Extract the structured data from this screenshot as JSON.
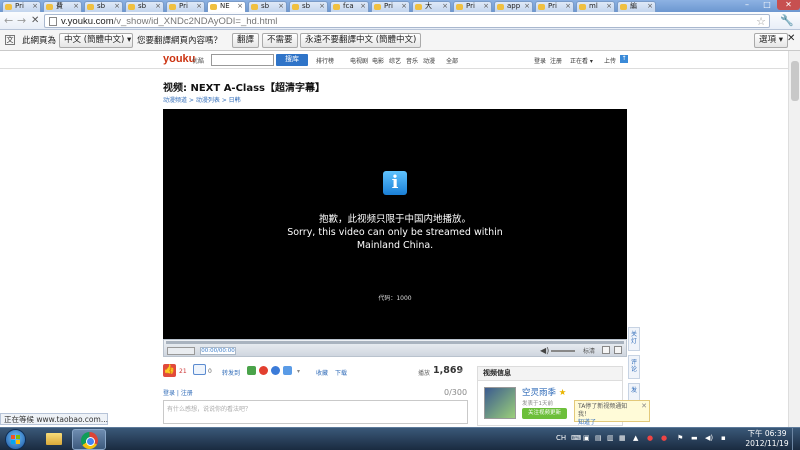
{
  "tabs": [
    {
      "title": "Pri"
    },
    {
      "title": "費"
    },
    {
      "title": "sb"
    },
    {
      "title": "sb"
    },
    {
      "title": "Pri"
    },
    {
      "title": "NE",
      "active": true
    },
    {
      "title": "sb"
    },
    {
      "title": "sb"
    },
    {
      "title": "fca"
    },
    {
      "title": "Pri"
    },
    {
      "title": "大"
    },
    {
      "title": "Pri"
    },
    {
      "title": "app"
    },
    {
      "title": "Pri"
    },
    {
      "title": "ml"
    },
    {
      "title": "編"
    }
  ],
  "toolbar": {
    "url_host": "v.youku.com",
    "url_path": "/v_show/id_XNDc2NDAyODI=_hd.html"
  },
  "translate": {
    "prefix": "此網頁為",
    "language": "中文 (簡體中文)",
    "question": "您要翻譯網頁內容嗎？",
    "translate_btn": "翻譯",
    "nope_btn": "不需要",
    "never_btn": "永遠不要翻譯中文 (簡體中文)",
    "options_btn": "選項"
  },
  "youku": {
    "logo": "youku",
    "logo_sub": "优酷",
    "search_btn": "搜库",
    "nav": [
      "排行榜",
      "电视剧",
      "电影",
      "综艺",
      "音乐",
      "动漫",
      "全部"
    ],
    "right": [
      "登录",
      "注册",
      "正在看",
      "上传"
    ],
    "title": "视频: NEXT A-Class【超清字幕】",
    "breadcrumb": "动漫频道 > 动漫列表 > 日韩",
    "player": {
      "msg_cn": "抱歉，此视频只限于中国内地播放。",
      "msg_en_1": "Sorry, this video can only be streamed within",
      "msg_en_2": "Mainland China.",
      "code": "代码：1000",
      "time": "00:00/00:00",
      "hd": "标清"
    },
    "side_tabs": [
      "关灯",
      "评论",
      "发"
    ],
    "actions": {
      "likes": "21",
      "comments": "0",
      "repost": "转发到",
      "favorite": "收藏",
      "download": "下载"
    },
    "plays_label": "播放",
    "plays_value": "1,869",
    "login_links": "登录 | 注册",
    "char_count": "0/300",
    "comment_placeholder": "有什么感想，说说你的看法吧？",
    "info_panel": {
      "heading": "视频信息",
      "uploader": "空灵雨季",
      "uploader_sub": "发表于1天前",
      "subscribe": "关注视频更新"
    },
    "notice": {
      "text": "TA停了新视频通知我！",
      "link": "知道了"
    }
  },
  "statusbar": "正在等候 www.taobao.com...",
  "taskbar": {
    "lang": "CH",
    "clock_time": "下午 06:39",
    "clock_date": "2012/11/19"
  }
}
